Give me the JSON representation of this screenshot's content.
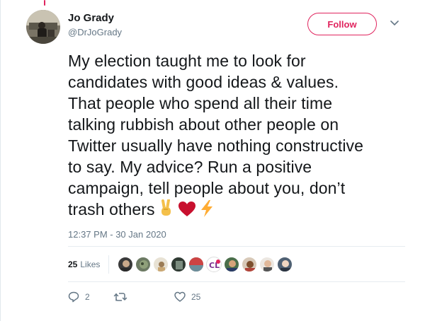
{
  "author": {
    "name": "Jo Grady",
    "handle": "@DrJoGrady"
  },
  "follow_button": {
    "label": "Follow"
  },
  "tweet": {
    "lines": [
      "My election taught me to look for",
      "candidates with good ideas & values.",
      "That people who spend all their time",
      "talking rubbish about other people on",
      "Twitter usually have nothing constructive",
      "to say. My advice? Run a positive",
      "campaign, tell people about you, don’t",
      "trash others"
    ],
    "emojis": [
      "victory-hand-emoji",
      "red-heart-emoji",
      "high-voltage-emoji"
    ],
    "timestamp": "12:37 PM - 30 Jan 2020"
  },
  "likes": {
    "count": "25",
    "label": "Likes",
    "liker_avatars": 10
  },
  "actions": {
    "replies": "2",
    "retweets": "",
    "likes": "25"
  },
  "colors": {
    "accent": "#e0245e",
    "muted": "#657786",
    "text": "#14171a",
    "divider": "#e6ecf0"
  }
}
